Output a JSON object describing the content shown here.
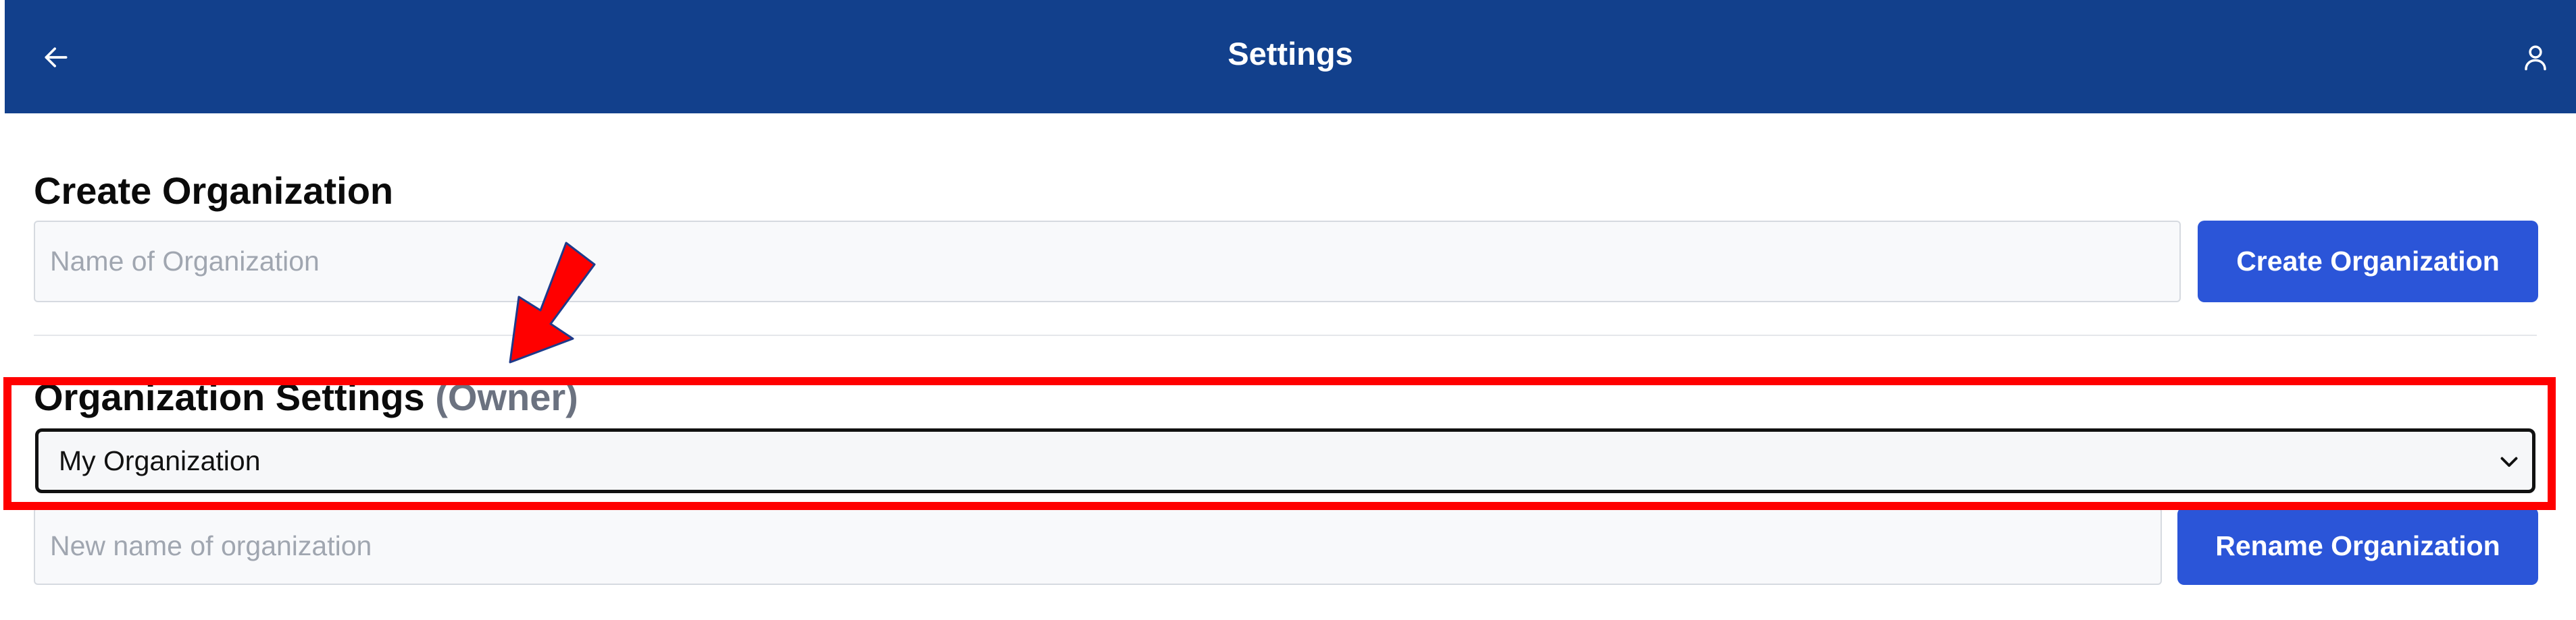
{
  "header": {
    "title": "Settings",
    "back_icon": "arrow-left-icon",
    "user_icon": "user-icon",
    "background": "#12408c"
  },
  "create_org": {
    "heading": "Create Organization",
    "input_placeholder": "Name of Organization",
    "input_value": "",
    "button_label": "Create Organization"
  },
  "org_settings": {
    "heading": "Organization Settings",
    "role": "(Owner)",
    "selected_org": "My Organization",
    "chevron_icon": "chevron-down-icon",
    "rename_placeholder": "New name of organization",
    "rename_value": "",
    "rename_button_label": "Rename Organization"
  },
  "annotations": {
    "highlight_color": "#ff0000",
    "arrow_color": "#ff0000"
  }
}
